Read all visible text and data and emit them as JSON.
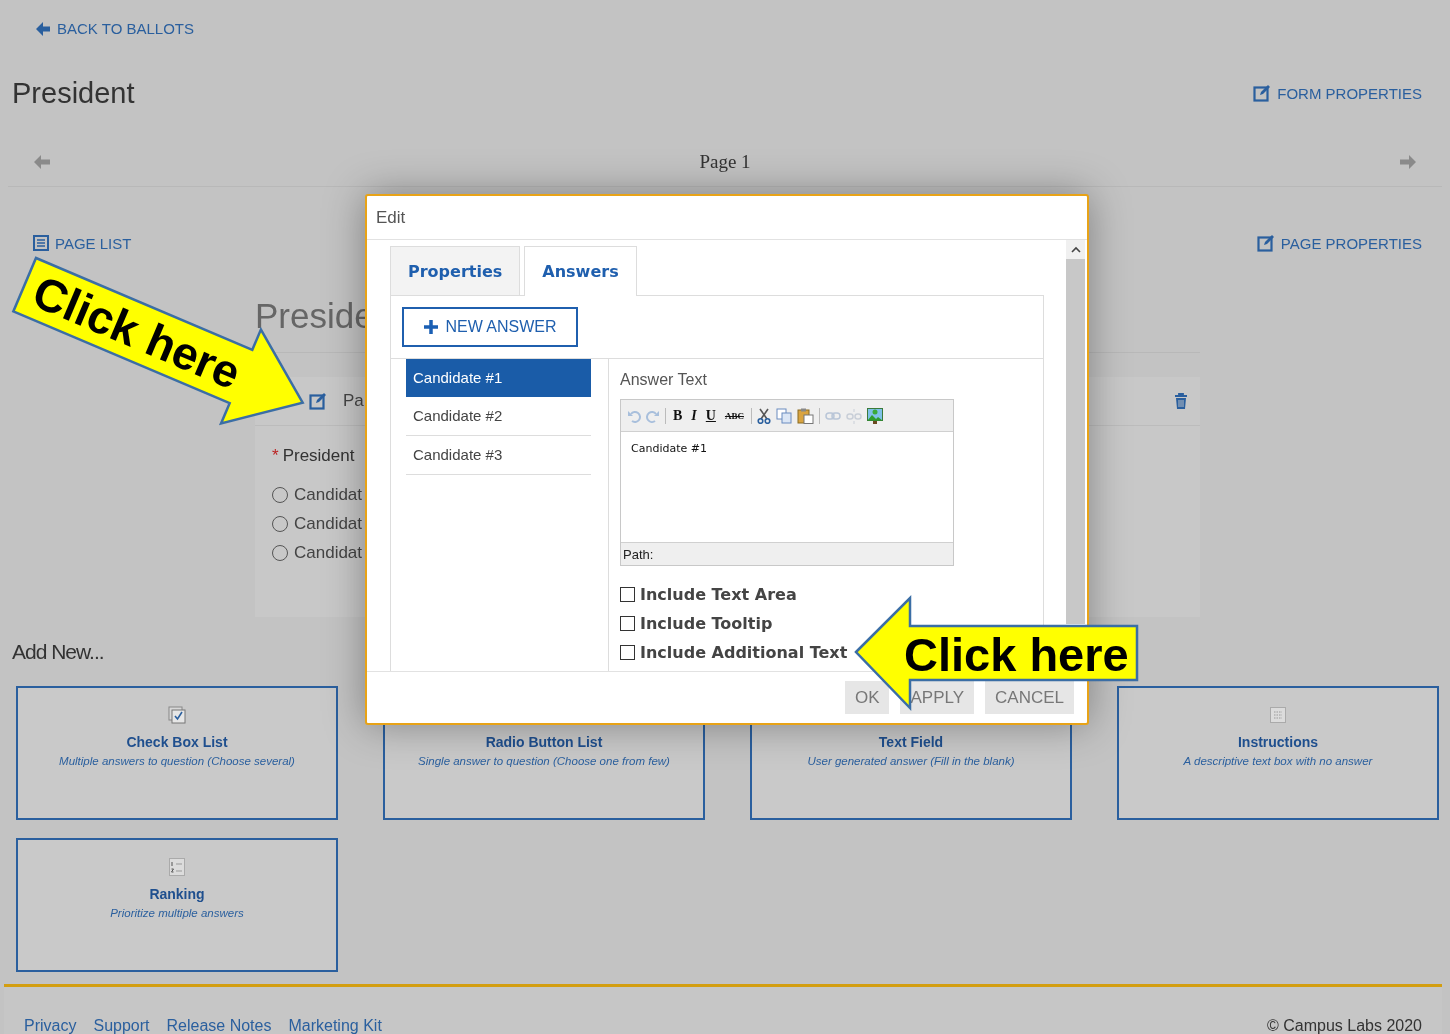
{
  "back_link": "BACK TO BALLOTS",
  "title": "President",
  "form_properties": "FORM PROPERTIES",
  "pager": {
    "label": "Page 1"
  },
  "page_list": "PAGE LIST",
  "page_properties": "PAGE PROPERTIES",
  "section": {
    "heading": "Preside",
    "question_header": "Pa",
    "question": {
      "required_mark": "*",
      "label": "President",
      "options": [
        {
          "label": "Candidat",
          "selected": false
        },
        {
          "label": "Candidat",
          "selected": false
        },
        {
          "label": "Candidat",
          "selected": false
        }
      ]
    }
  },
  "add_new": {
    "heading": "Add New...",
    "items": [
      {
        "kind": "checkbox_list",
        "title": "Check Box List",
        "description": "Multiple answers to question (Choose several)"
      },
      {
        "kind": "radio_list",
        "title": "Radio Button List",
        "description": "Single answer to question (Choose one from few)"
      },
      {
        "kind": "text_field",
        "title": "Text Field",
        "description": "User generated answer (Fill in the blank)"
      },
      {
        "kind": "instructions",
        "title": "Instructions",
        "description": "A descriptive text box with no answer"
      },
      {
        "kind": "ranking",
        "title": "Ranking",
        "description": "Prioritize multiple answers"
      }
    ]
  },
  "footer": {
    "links": [
      "Privacy",
      "Support",
      "Release Notes",
      "Marketing Kit"
    ],
    "copyright": "© Campus Labs 2020"
  },
  "dialog": {
    "title": "Edit",
    "tabs": [
      {
        "label": "Properties",
        "selected": false
      },
      {
        "label": "Answers",
        "selected": true
      }
    ],
    "new_answer": "NEW ANSWER",
    "answers": [
      {
        "label": "Candidate #1",
        "selected": true
      },
      {
        "label": "Candidate #2",
        "selected": false
      },
      {
        "label": "Candidate #3",
        "selected": false
      }
    ],
    "answer_text_label": "Answer Text",
    "editor": {
      "format_buttons": [
        "B",
        "I",
        "U",
        "ABC"
      ],
      "value": "Candidate #1",
      "path_label": "Path:"
    },
    "options": [
      {
        "label": "Include Text Area",
        "checked": false
      },
      {
        "label": "Include Tooltip",
        "checked": false
      },
      {
        "label": "Include Additional Text",
        "checked": false
      }
    ],
    "buttons": [
      "OK",
      "APPLY",
      "CANCEL"
    ]
  },
  "callouts": [
    {
      "text": "Click here"
    },
    {
      "text": "Click here"
    }
  ]
}
